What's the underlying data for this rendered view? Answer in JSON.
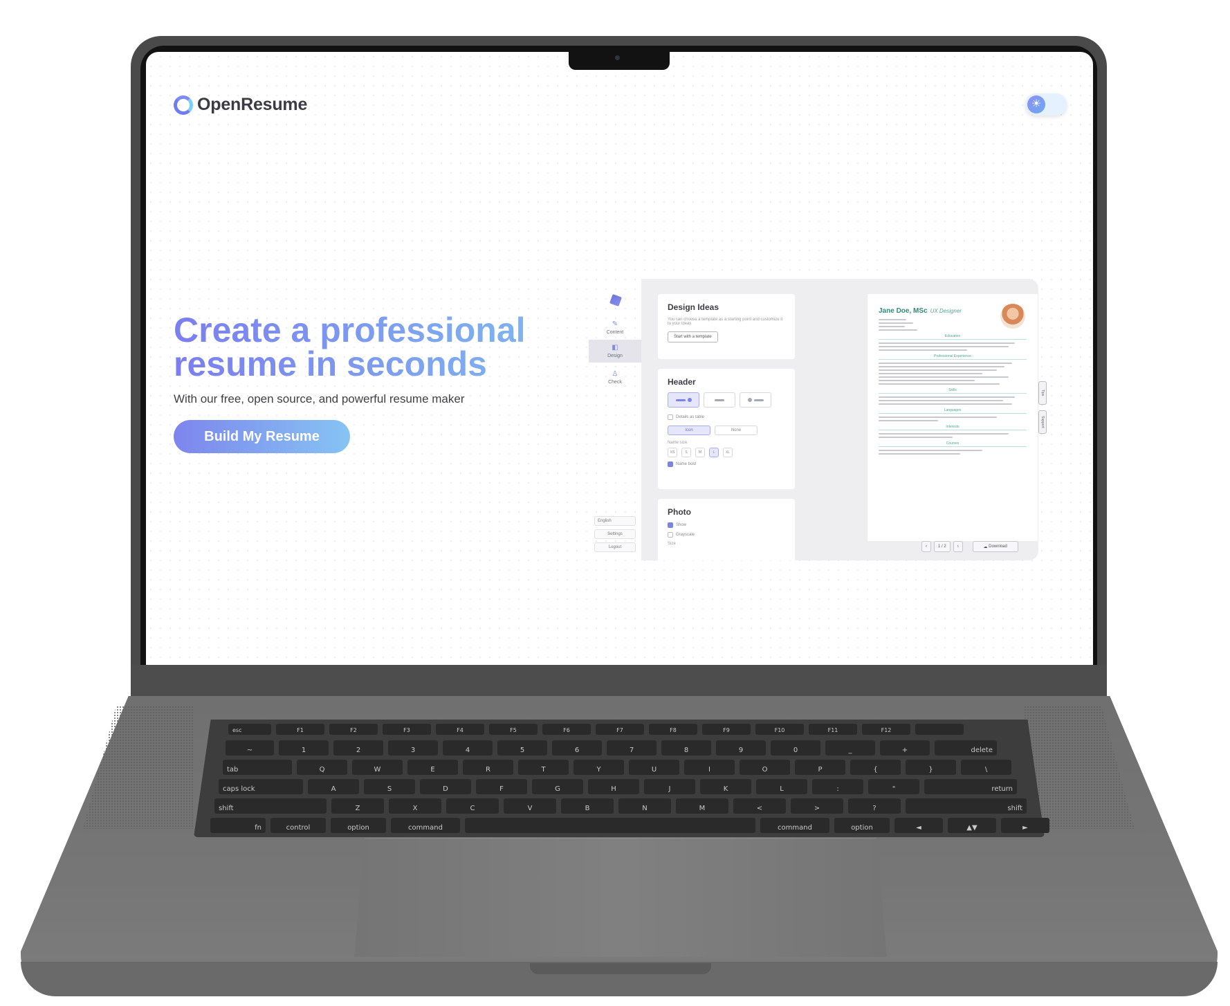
{
  "brand": {
    "name": "OpenResume"
  },
  "hero": {
    "title": "Create a professional resume in seconds",
    "subtitle": "With our free, open source, and powerful resume maker",
    "cta_label": "Build My Resume"
  },
  "theme_toggle": {
    "icon": "sun-icon",
    "mode": "light"
  },
  "preview": {
    "nav": [
      {
        "label": "Content",
        "icon": "edit-icon"
      },
      {
        "label": "Design",
        "icon": "palette-icon"
      },
      {
        "label": "Check",
        "icon": "check-icon"
      }
    ],
    "bottom": {
      "language": "English",
      "settings": "Settings",
      "logout": "Logout"
    },
    "design_ideas": {
      "title": "Design Ideas",
      "text": "You can choose a template as a starting point and customize it to your ideas",
      "button": "Start with a template"
    },
    "header": {
      "title": "Header",
      "details_label": "Details as table",
      "icon_option": "Icon",
      "none_option": "None",
      "name_size_label": "Name size",
      "sizes": [
        "XS",
        "S",
        "M",
        "L",
        "XL"
      ],
      "name_bold": "Name bold"
    },
    "photo": {
      "title": "Photo",
      "show": "Show",
      "grayscale": "Grayscale",
      "size_label": "Size"
    },
    "resume": {
      "name": "Jane Doe, MSc",
      "role": "UX Designer",
      "sections": [
        "Education",
        "Professional Experience",
        "Skills",
        "Languages",
        "Interests",
        "Courses"
      ]
    },
    "pager": {
      "page": "1 / 2",
      "download": "Download"
    },
    "side_tabs": [
      "Tips",
      "Support"
    ]
  },
  "keyboard": {
    "fn_row": [
      "esc",
      "F1",
      "F2",
      "F3",
      "F4",
      "F5",
      "F6",
      "F7",
      "F8",
      "F9",
      "F10",
      "F11",
      "F12",
      ""
    ],
    "num_row": [
      "~",
      "1",
      "2",
      "3",
      "4",
      "5",
      "6",
      "7",
      "8",
      "9",
      "0",
      "_",
      "+",
      "delete"
    ],
    "top_row": [
      "tab",
      "Q",
      "W",
      "E",
      "R",
      "T",
      "Y",
      "U",
      "I",
      "O",
      "P",
      "{",
      "}",
      "\\"
    ],
    "home_row": [
      "caps lock",
      "A",
      "S",
      "D",
      "F",
      "G",
      "H",
      "J",
      "K",
      "L",
      ":",
      "\"",
      "return"
    ],
    "bottom_row": [
      "shift",
      "Z",
      "X",
      "C",
      "V",
      "B",
      "N",
      "M",
      "<",
      ">",
      "?",
      "shift"
    ],
    "space_row": [
      "fn",
      "control",
      "option",
      "command",
      "",
      "command",
      "option",
      "◄",
      "▲▼",
      "►"
    ]
  }
}
